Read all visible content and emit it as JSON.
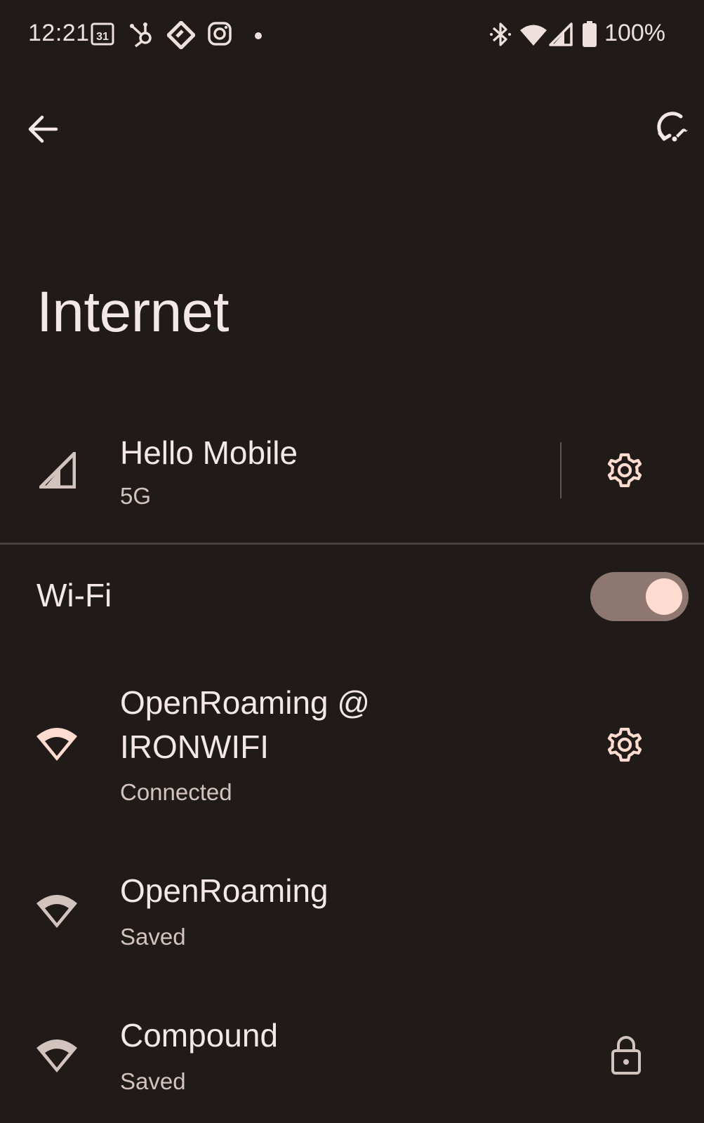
{
  "status_bar": {
    "time": "12:21",
    "calendar_day": "31",
    "battery_percent": "100%",
    "icons": [
      "calendar-icon",
      "hubspot-icon",
      "diamond-app-icon",
      "instagram-icon",
      "dot-icon",
      "bluetooth-icon",
      "wifi-icon",
      "cell-signal-icon",
      "battery-icon"
    ]
  },
  "toolbar": {
    "back_icon": "arrow-back-icon",
    "action_icon": "network-reset-icon"
  },
  "page": {
    "title": "Internet"
  },
  "mobile": {
    "name": "Hello Mobile",
    "network_type": "5G",
    "icon": "cell-signal-icon",
    "settings_icon": "gear-icon"
  },
  "wifi": {
    "label": "Wi-Fi",
    "enabled": true,
    "networks": [
      {
        "name_line1": "OpenRoaming @",
        "name_line2": "IRONWIFI",
        "status": "Connected",
        "action_icon": "gear-icon"
      },
      {
        "name": "OpenRoaming",
        "status": "Saved"
      },
      {
        "name": "Compound",
        "status": "Saved",
        "action_icon": "lock-icon"
      }
    ]
  },
  "colors": {
    "background": "#201a19",
    "text_primary": "#f3e8e5",
    "text_secondary": "#d3c3bf",
    "toggle_track": "#8f7771",
    "toggle_thumb": "#ffdccf",
    "wifi_connected": "#ffdccf"
  }
}
